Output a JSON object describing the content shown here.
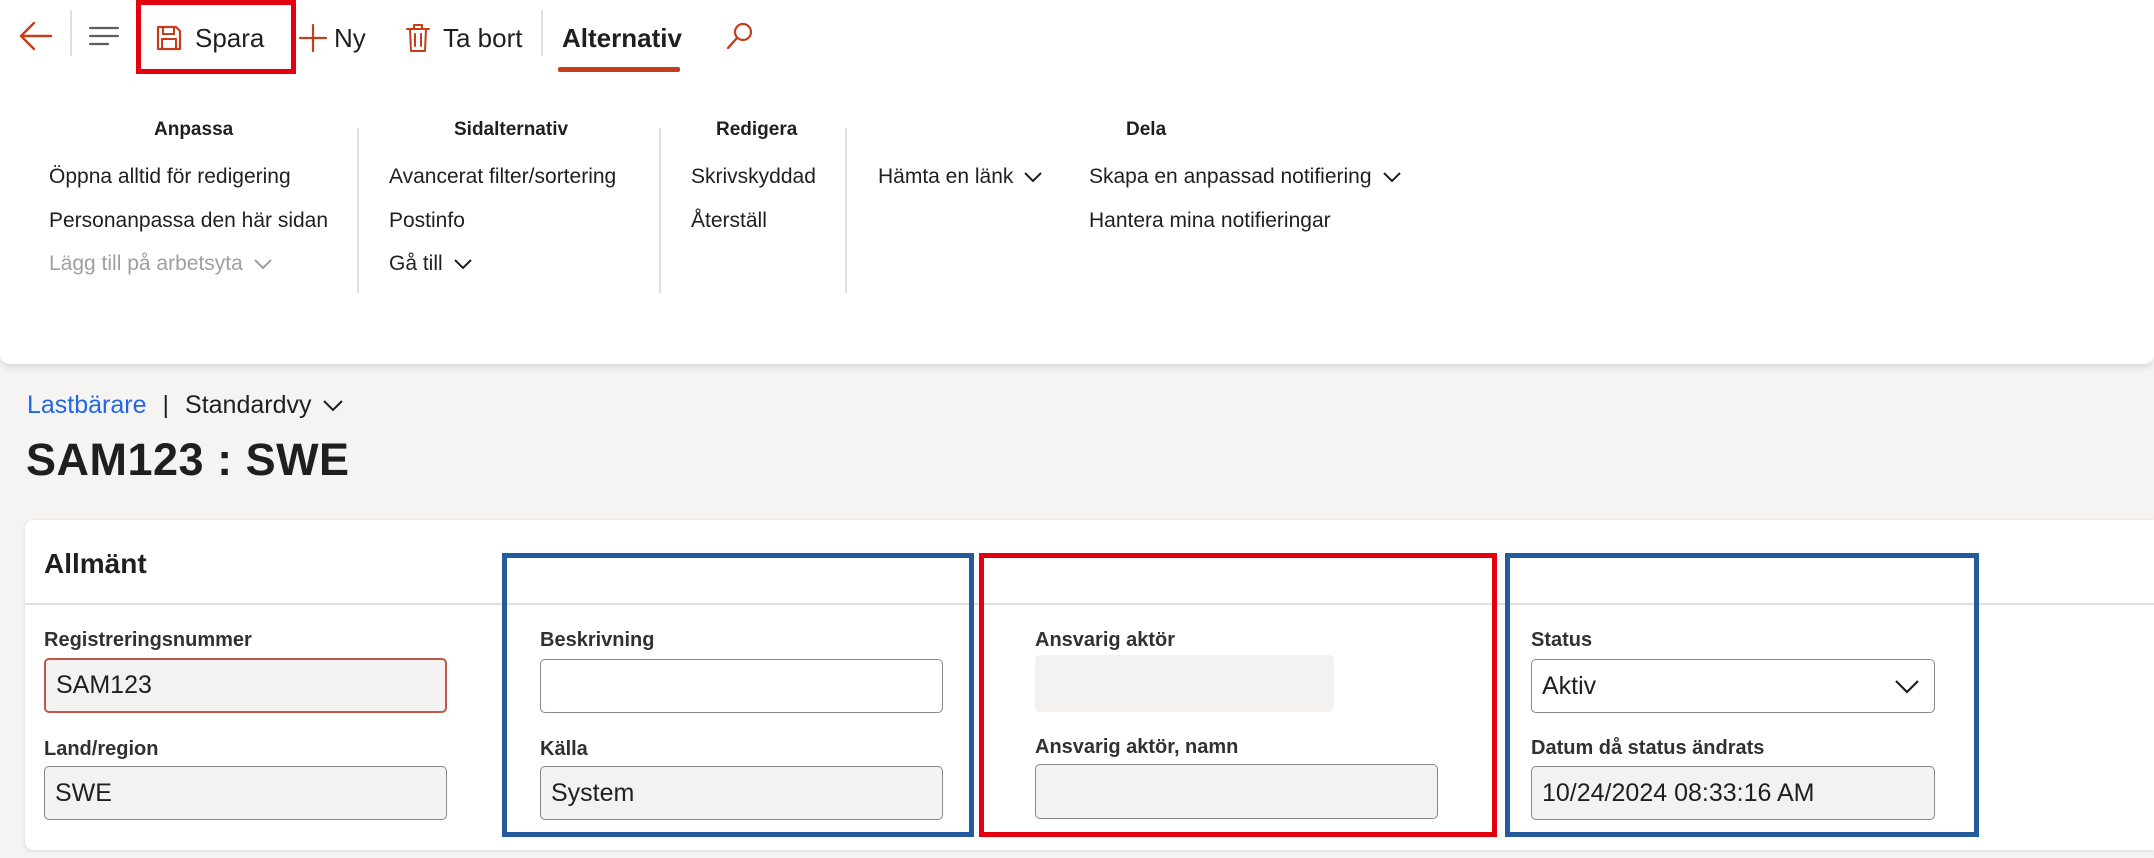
{
  "toolbar": {
    "back_icon": "arrow-left-icon",
    "menu_icon": "hamburger-icon",
    "save_label": "Spara",
    "new_label": "Ny",
    "delete_label": "Ta bort",
    "options_tab_label": "Alternativ",
    "search_icon": "search-icon",
    "accent_color": "#c43e1c"
  },
  "ribbon": {
    "groups": [
      {
        "title": "Anpassa",
        "items": [
          "Öppna alltid för redigering",
          "Personanpassa den här sidan",
          "Lägg till på arbetsyta"
        ]
      },
      {
        "title": "Sidalternativ",
        "items": [
          "Avancerat filter/sortering",
          "Postinfo",
          "Gå till"
        ]
      },
      {
        "title": "Redigera",
        "items": [
          "Skrivskyddad",
          "Återställ"
        ]
      },
      {
        "title": "Dela",
        "items": [
          "Hämta en länk",
          "Skapa en anpassad notifiering",
          "Hantera mina notifieringar"
        ]
      }
    ]
  },
  "page": {
    "breadcrumb_link": "Lastbärare",
    "breadcrumb_separator": "|",
    "view_name": "Standardvy",
    "title": "SAM123 : SWE"
  },
  "general": {
    "section_title": "Allmänt",
    "fields": {
      "reg_number": {
        "label": "Registreringsnummer",
        "value": "SAM123"
      },
      "country": {
        "label": "Land/region",
        "value": "SWE"
      },
      "description": {
        "label": "Beskrivning",
        "value": ""
      },
      "source": {
        "label": "Källa",
        "value": "System"
      },
      "responsible": {
        "label": "Ansvarig aktör",
        "value": ""
      },
      "responsible_name": {
        "label": "Ansvarig aktör, namn",
        "value": ""
      },
      "status": {
        "label": "Status",
        "value": "Aktiv"
      },
      "status_date": {
        "label": "Datum då status ändrats",
        "value": "10/24/2024 08:33:16 AM"
      }
    }
  },
  "colors": {
    "highlight_red": "#e3000f",
    "highlight_blue": "#245b9c",
    "link_blue": "#2266e3"
  }
}
